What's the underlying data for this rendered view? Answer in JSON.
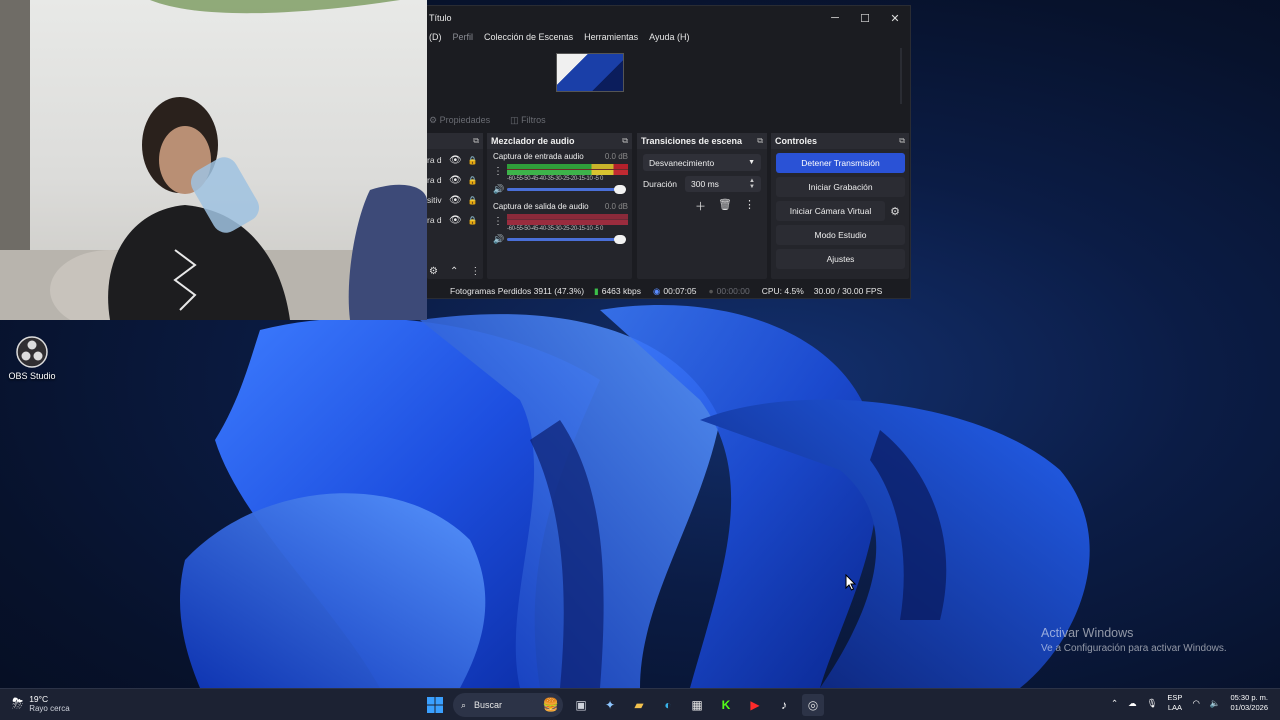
{
  "obs_window": {
    "title": "Título",
    "window_controls": {
      "minimize": "─",
      "maximize": "☐",
      "close": "✕"
    },
    "menu": [
      "(D)",
      "Perfil",
      "Colección de Escenas",
      "Herramientas",
      "Ayuda (H)"
    ],
    "toolbar": {
      "properties": "Propiedades",
      "filters": "Filtros"
    },
    "sources": {
      "items": [
        {
          "name": "ra d"
        },
        {
          "name": "ra d"
        },
        {
          "name": "sitiv"
        },
        {
          "name": "ra d"
        }
      ]
    },
    "audio_mixer": {
      "title": "Mezclador de audio",
      "channels": [
        {
          "name": "Captura de entrada audio",
          "db": "0.0 dB",
          "level": 0.85
        },
        {
          "name": "Captura de salida de audio",
          "db": "0.0 dB",
          "level": 0.0
        }
      ],
      "ticks": "-60-55-50-45-40-35-30-25-20-15-10 -5 0"
    },
    "scene_transitions": {
      "title": "Transiciones de escena",
      "selected": "Desvanecimiento",
      "duration_label": "Duración",
      "duration_value": "300 ms"
    },
    "controls": {
      "title": "Controles",
      "stop_stream": "Detener Transmisión",
      "start_recording": "Iniciar Grabación",
      "virtual_camera": "Iniciar Cámara Virtual",
      "studio_mode": "Modo Estudio",
      "settings": "Ajustes"
    },
    "status": {
      "dropped_frames": "Fotogramas Perdidos 3911 (47.3%)",
      "bitrate": "6463 kbps",
      "stream_time": "00:07:05",
      "record_time": "00:00:00",
      "cpu": "CPU: 4.5%",
      "fps": "30.00 / 30.00 FPS"
    }
  },
  "desktop": {
    "icon_label": "OBS Studio",
    "activate_title": "Activar Windows",
    "activate_sub": "Ve a Configuración para activar Windows."
  },
  "taskbar": {
    "weather_temp": "19°C",
    "weather_desc": "Rayo cerca",
    "search_placeholder": "Buscar",
    "lang_top": "ESP",
    "lang_bottom": "LAA",
    "time": "05:30 p. m.",
    "date": "01/03/2026"
  },
  "colors": {
    "accent": "#2a52d6",
    "panel": "#24252b",
    "window": "#1b1c21"
  }
}
